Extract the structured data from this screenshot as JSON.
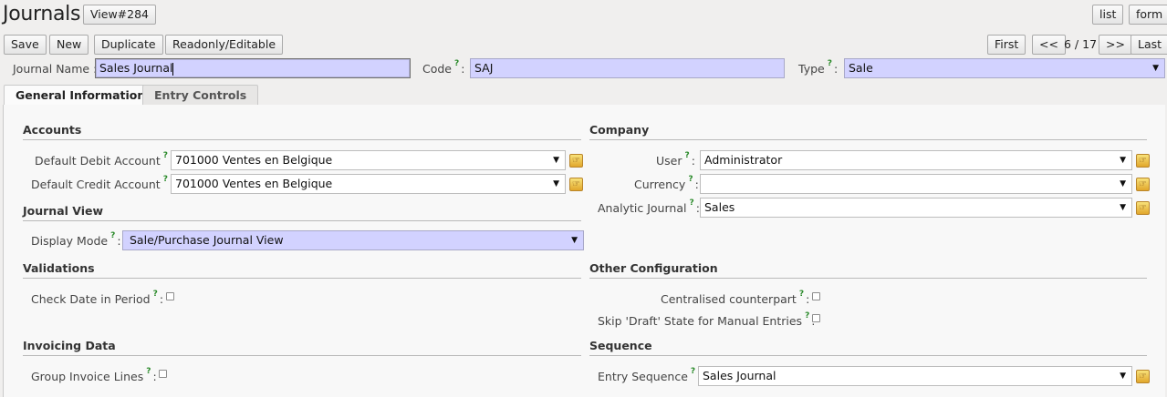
{
  "header": {
    "title": "Journals",
    "view_badge": "View#284",
    "list_label": "list",
    "form_label": "form"
  },
  "toolbar": {
    "save_label": "Save",
    "new_label": "New",
    "duplicate_label": "Duplicate",
    "readonly_label": "Readonly/Editable",
    "first_label": "First",
    "prev_label": "<<",
    "pager_text": "6 / 17",
    "next_label": ">>",
    "last_label": "Last"
  },
  "top_fields": {
    "journal_name_label": "Journal Name",
    "journal_name_value": "Sales Journal",
    "code_label": "Code",
    "code_value": "SAJ",
    "type_label": "Type",
    "type_value": "Sale"
  },
  "tabs": [
    {
      "label": "General Information",
      "active": true
    },
    {
      "label": "Entry Controls",
      "active": false
    }
  ],
  "general": {
    "accounts": {
      "title": "Accounts",
      "debit_label": "Default Debit Account",
      "debit_value": "701000 Ventes en Belgique",
      "credit_label": "Default Credit Account",
      "credit_value": "701000 Ventes en Belgique"
    },
    "journal_view": {
      "title": "Journal View",
      "display_mode_label": "Display Mode",
      "display_mode_value": "Sale/Purchase Journal View"
    },
    "validations": {
      "title": "Validations",
      "check_date_label": "Check Date in Period"
    },
    "invoicing": {
      "title": "Invoicing Data",
      "group_lines_label": "Group Invoice Lines"
    },
    "company": {
      "title": "Company",
      "user_label": "User",
      "user_value": "Administrator",
      "currency_label": "Currency",
      "currency_value": "",
      "analytic_label": "Analytic Journal",
      "analytic_value": "Sales"
    },
    "other_config": {
      "title": "Other Configuration",
      "centralised_label": "Centralised counterpart",
      "skip_draft_label": "Skip 'Draft' State for Manual Entries"
    },
    "sequence": {
      "title": "Sequence",
      "entry_sequence_label": "Entry Sequence",
      "entry_sequence_value": "Sales Journal"
    }
  },
  "help_mark": "?",
  "colon": ":",
  "dropdown_caret": "▼",
  "icons": {
    "open_record": "open-record-icon"
  }
}
